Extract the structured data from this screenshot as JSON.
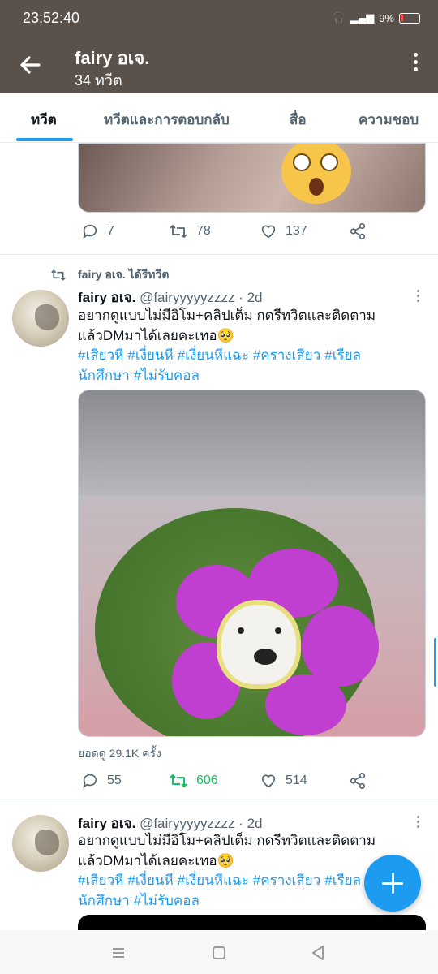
{
  "status_bar": {
    "time": "23:52:40",
    "battery": "9%"
  },
  "header": {
    "title": "fairy อเจ.",
    "subtitle": "34 ทวีต"
  },
  "tabs": [
    {
      "label": "ทวีต",
      "active": true
    },
    {
      "label": "ทวีตและการตอบกลับ",
      "active": false
    },
    {
      "label": "สื่อ",
      "active": false
    },
    {
      "label": "ความชอบ",
      "active": false
    }
  ],
  "tweet1_actions": {
    "replies": "7",
    "retweets": "78",
    "likes": "137"
  },
  "retweet_label": "fairy อเจ. ได้รีทวีต",
  "tweet2": {
    "name": "fairy อเจ.",
    "handle": "@fairyyyyyzzzz",
    "dot": "·",
    "time": "2d",
    "text": "อยากดูแบบไม่มีอิโม+คลิปเต็ม กดรีทวิตและติดตาม แล้วDMมาได้เลยคะเทอ🥺",
    "hashtags": [
      "#เสียวหี",
      "#เงี่ยนหี",
      "#เงี่ยนหีแฉะ",
      "#ครางเสียว",
      "#เรียล",
      "นักศึกษา",
      "#ไม่รับคอล"
    ],
    "views": "ยอดดู 29.1K ครั้ง",
    "replies": "55",
    "retweets": "606",
    "likes": "514"
  },
  "tweet3": {
    "name": "fairy อเจ.",
    "handle": "@fairyyyyyzzzz",
    "dot": "·",
    "time": "2d",
    "text": "อยากดูแบบไม่มีอิโม+คลิปเต็ม กดรีทวิตและติดตาม แล้วDMมาได้เลยคะเทอ🥺",
    "hashtags": [
      "#เสียวหี",
      "#เงี่ยนหี",
      "#เงี่ยนหีแฉะ",
      "#ครางเสียว",
      "#เรียล",
      "นักศึกษา",
      "#ไม่รับคอล"
    ]
  },
  "colors": {
    "accent": "#1d9bf0",
    "retweet_green": "#17bf63",
    "header_bg": "#5a514b"
  }
}
